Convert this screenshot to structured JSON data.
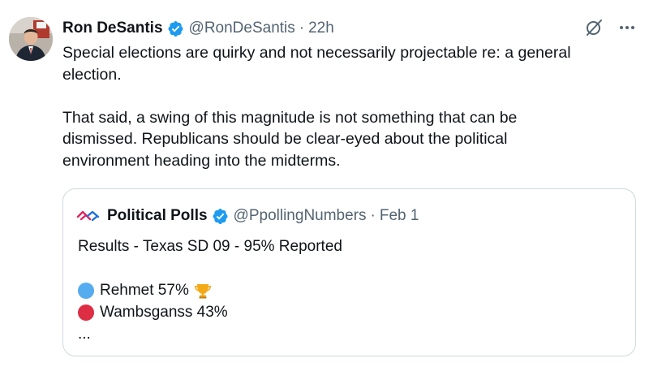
{
  "author": {
    "name": "Ron DeSantis",
    "handle": "@RonDeSantis",
    "separator": "·",
    "time": "22h",
    "avatar_icon": "person-portrait-icon",
    "verified_color": "#1d9bf0"
  },
  "actions": {
    "grok_icon": "slash-circle-icon",
    "more_icon": "more-dots-icon"
  },
  "tweet": {
    "line_1": "Special elections are quirky and not necessarily projectable re: a general",
    "line_2": "election.",
    "line_3": "That said, a swing of this magnitude is not something that can be",
    "line_4": "dismissed.  Republicans should be clear-eyed about the political",
    "line_5": "environment heading into the midterms."
  },
  "quote": {
    "name": "Political Polls",
    "handle": "@PpollingNumbers",
    "separator": "·",
    "date": "Feb 1",
    "logo_icon": "political-polls-logo-icon",
    "title": "Results - Texas SD 09 - 95% Reported",
    "results": [
      {
        "label": "Rehmet 57%",
        "color": "#55acee",
        "icon": "blue-circle-icon",
        "winner_icon": "trophy-icon"
      },
      {
        "label": "Wambsganss 43%",
        "color": "#dd2e44",
        "icon": "red-circle-icon"
      }
    ],
    "ellipsis": "..."
  }
}
